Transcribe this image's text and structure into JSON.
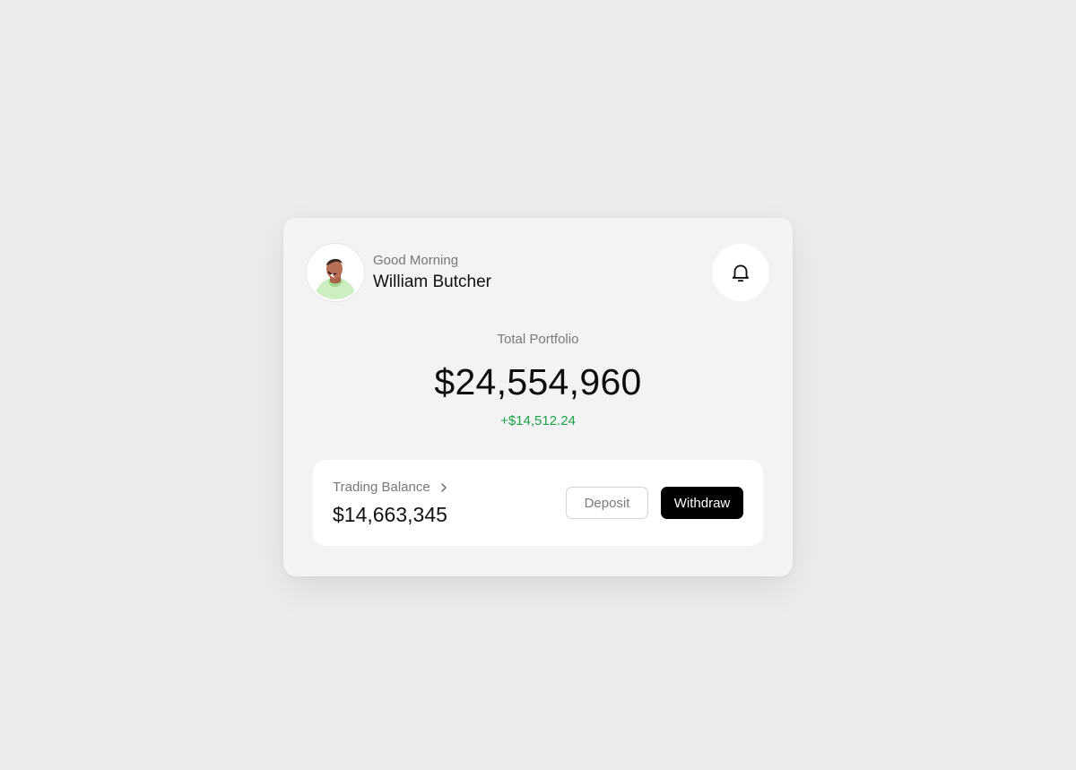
{
  "user": {
    "greeting": "Good Morning",
    "name": "William Butcher",
    "avatar_icon": "user-avatar-illustration"
  },
  "header": {
    "notification_icon": "bell-icon"
  },
  "portfolio": {
    "label": "Total Portfolio",
    "value": "$24,554,960",
    "change": "+$14,512.24",
    "change_color": "#1aa34a"
  },
  "trading": {
    "label": "Trading Balance",
    "chevron_icon": "chevron-right-icon",
    "value": "$14,663,345",
    "deposit_label": "Deposit",
    "withdraw_label": "Withdraw"
  }
}
